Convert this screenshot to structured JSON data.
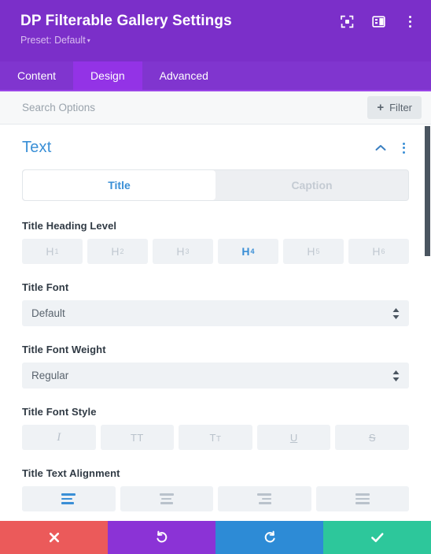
{
  "header": {
    "title": "DP Filterable Gallery Settings",
    "preset_label": "Preset: Default",
    "preset_caret": "▾",
    "icons": [
      {
        "name": "focus-mode-icon"
      },
      {
        "name": "layout-panel-icon"
      },
      {
        "name": "more-options-icon"
      }
    ]
  },
  "tabs": [
    {
      "label": "Content",
      "active": false
    },
    {
      "label": "Design",
      "active": true
    },
    {
      "label": "Advanced",
      "active": false
    }
  ],
  "search": {
    "placeholder": "Search Options",
    "value": "",
    "filter_label": "Filter",
    "filter_plus": "+"
  },
  "section": {
    "title": "Text",
    "collapse_icon": "chevron-up-icon",
    "menu_icon": "more-options-icon"
  },
  "toggle": {
    "items": [
      {
        "label": "Title",
        "active": true
      },
      {
        "label": "Caption",
        "active": false
      }
    ]
  },
  "fields": {
    "heading_level": {
      "label": "Title Heading Level",
      "options": [
        {
          "letter": "H",
          "num": "1",
          "active": false
        },
        {
          "letter": "H",
          "num": "2",
          "active": false
        },
        {
          "letter": "H",
          "num": "3",
          "active": false
        },
        {
          "letter": "H",
          "num": "4",
          "active": true
        },
        {
          "letter": "H",
          "num": "5",
          "active": false
        },
        {
          "letter": "H",
          "num": "6",
          "active": false
        }
      ]
    },
    "title_font": {
      "label": "Title Font",
      "value": "Default"
    },
    "title_font_weight": {
      "label": "Title Font Weight",
      "value": "Regular"
    },
    "title_font_style": {
      "label": "Title Font Style",
      "options": [
        {
          "name": "italic",
          "glyph": "I",
          "active": false
        },
        {
          "name": "uppercase",
          "glyph": "TT",
          "active": false
        },
        {
          "name": "small-caps",
          "glyph": "TT",
          "active": false
        },
        {
          "name": "underline",
          "glyph": "U",
          "active": false
        },
        {
          "name": "strikethrough",
          "glyph": "S",
          "active": false
        }
      ]
    },
    "title_text_alignment": {
      "label": "Title Text Alignment",
      "options": [
        {
          "name": "align-left",
          "active": true
        },
        {
          "name": "align-center",
          "active": false
        },
        {
          "name": "align-right",
          "active": false
        },
        {
          "name": "align-justify",
          "active": false
        }
      ]
    }
  },
  "footer": {
    "buttons": [
      {
        "name": "cancel-button",
        "icon": "close-icon",
        "color": "#EB5A5A"
      },
      {
        "name": "undo-button",
        "icon": "undo-icon",
        "color": "#8B33D6"
      },
      {
        "name": "redo-button",
        "icon": "redo-icon",
        "color": "#2D8BD6"
      },
      {
        "name": "save-button",
        "icon": "check-icon",
        "color": "#2DC79B"
      }
    ]
  },
  "colors": {
    "header_purple": "#7B2FC9",
    "tab_active_purple": "#9333E6",
    "accent_blue": "#3A8FD6",
    "panel_gray": "#EFF2F5"
  }
}
